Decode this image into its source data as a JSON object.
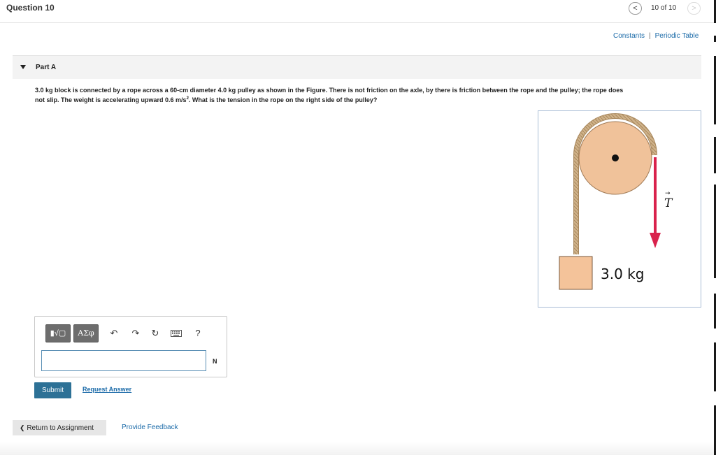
{
  "header": {
    "question_title": "Question 10",
    "prev_icon": "chevron-left-icon",
    "prev_glyph": "<",
    "counter": "10 of 10",
    "next_icon": "chevron-right-icon",
    "next_glyph": ">"
  },
  "links": {
    "constants": "Constants",
    "separator": "|",
    "periodic_table": "Periodic Table"
  },
  "part": {
    "title": "Part A",
    "toggle_icon": "caret-down-icon"
  },
  "problem": {
    "line1": "3.0 kg block is connected by a rope across a 60-cm diameter 4.0 kg pulley as shown in the Figure.   There is not friction on the axle, by there is friction between the rope and the pulley; the rope does",
    "line2_a": "not slip.  The weight is accelerating  upward 0.6 m/s",
    "line2_sup": "2",
    "line2_b": ". What is the tension in the rope on the right side of the pulley?"
  },
  "figure": {
    "mass_label": "3.0 kg",
    "tension_label": "T",
    "tension_arrow": "→"
  },
  "toolbar": {
    "templates_label": "▮√▢",
    "symbols_label": "ΑΣφ",
    "undo_icon": "undo-icon",
    "undo_glyph": "↶",
    "redo_icon": "redo-icon",
    "redo_glyph": "↷",
    "reset_icon": "reset-icon",
    "reset_glyph": "↻",
    "keyboard_icon": "keyboard-icon",
    "help_icon": "help-icon",
    "help_glyph": "?"
  },
  "answer": {
    "value": "",
    "unit": "N"
  },
  "actions": {
    "submit": "Submit",
    "request_answer": "Request Answer"
  },
  "footer": {
    "return_icon": "chevron-left-icon",
    "return_glyph": "❮",
    "return_label": "Return to Assignment",
    "feedback": "Provide Feedback"
  },
  "colors": {
    "accent_blue": "#2d7196",
    "link_blue": "#1a6aa8",
    "pulley_fill": "#f0c29a",
    "rope": "#c8a97a",
    "tension_arrow": "#d9224c"
  }
}
